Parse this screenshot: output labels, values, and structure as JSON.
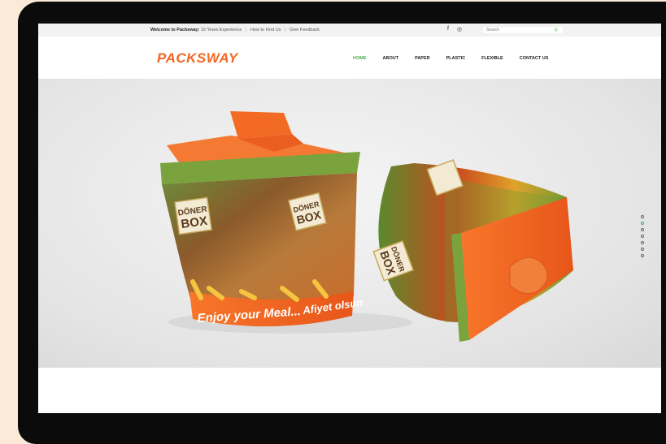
{
  "topbar": {
    "welcome_bold": "Welcome to Packsway:",
    "welcome_text": "15 Years Experience",
    "link_find": "How to Find Us",
    "link_feedback": "Give Feedback",
    "social": [
      "facebook-icon",
      "instagram-icon"
    ],
    "search_placeholder": "Search"
  },
  "nav": {
    "logo": "PACKSWAY",
    "items": [
      "HOME",
      "ABOUT",
      "PAPER",
      "PLASTIC",
      "FLEXIBLE",
      "CONTACT US"
    ],
    "active": "HOME"
  },
  "hero": {
    "box_label_line1": "DÖNER",
    "box_label_line2": "BOX",
    "slogan_left": "Enjoy your Meal...",
    "slogan_right": "Afiyet olsun",
    "slider_dots": 7,
    "active_dot": 2
  },
  "colors": {
    "accent": "#4caf50",
    "brand": "#f26722"
  }
}
